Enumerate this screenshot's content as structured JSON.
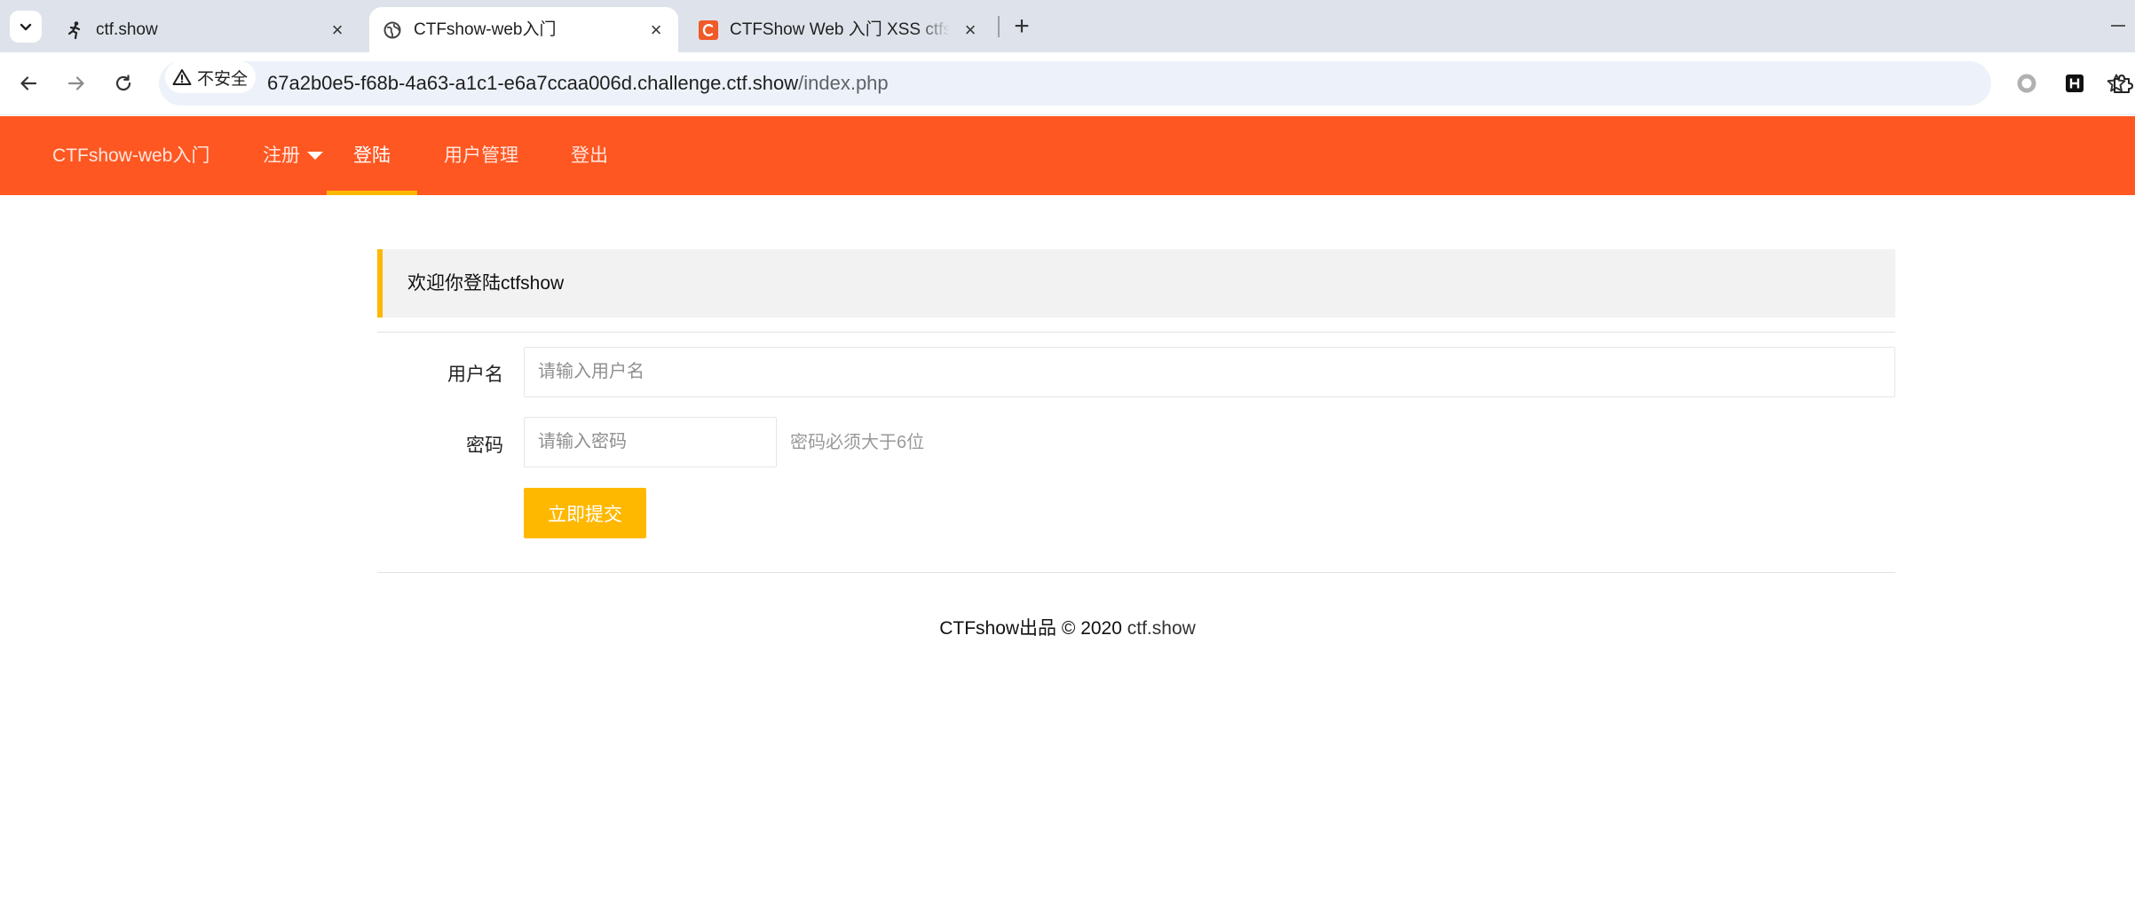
{
  "browser": {
    "tabs": [
      {
        "title": "ctf.show",
        "favicon": "running-person-icon"
      },
      {
        "title": "CTFshow-web入门",
        "favicon": "globe-icon"
      },
      {
        "title": "CTFShow Web 入门 XSS ctfsh",
        "favicon": "c-logo-icon"
      }
    ],
    "new_tab_label": "+",
    "security_chip": "不安全",
    "url_host": "67a2b0e5-f68b-4a63-a1c1-e6a7ccaa006d.challenge.ctf.show",
    "url_path": "/index.php"
  },
  "nav": {
    "brand": "CTFshow-web入门",
    "items": [
      {
        "label": "注册"
      },
      {
        "label": "登陆"
      },
      {
        "label": "用户管理"
      },
      {
        "label": "登出"
      }
    ],
    "active_index": 1
  },
  "form": {
    "welcome": "欢迎你登陆ctfshow",
    "username_label": "用户名",
    "username_placeholder": "请输入用户名",
    "password_label": "密码",
    "password_placeholder": "请输入密码",
    "password_hint": "密码必须大于6位",
    "submit_label": "立即提交"
  },
  "footer": {
    "text": "CTFshow出品 © 2020",
    "link": "ctf.show"
  },
  "colors": {
    "nav_bg": "#ff5722",
    "accent": "#ffb800"
  }
}
